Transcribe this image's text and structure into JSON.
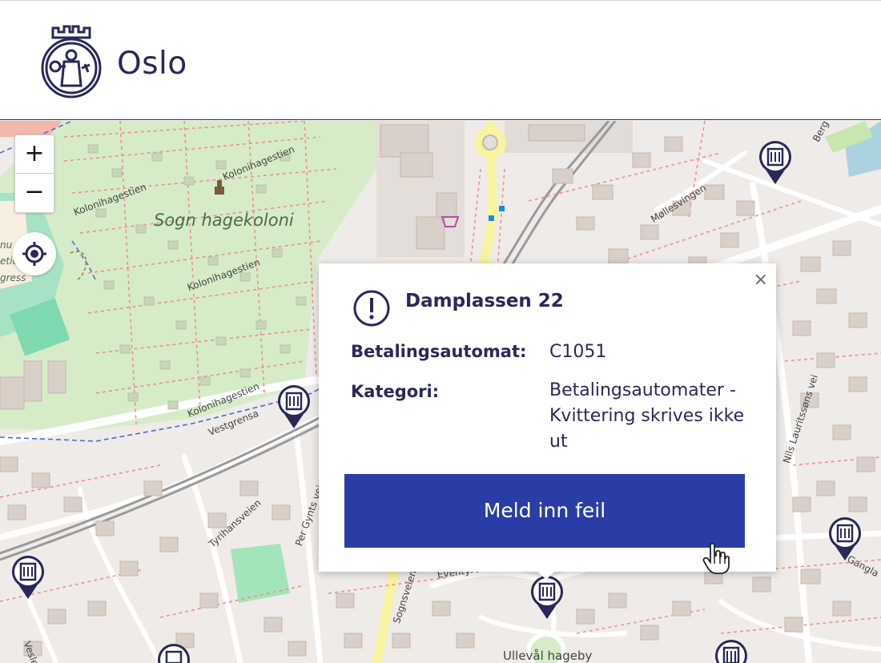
{
  "header": {
    "site_name": "Oslo"
  },
  "map": {
    "zoom_in": "+",
    "zoom_out": "−",
    "labels": {
      "park": "Sogn hagekoloni",
      "kolonihagestien": "Kolonihagestien",
      "vestgrensa": "Vestgrensa",
      "mollesvingen": "Møllesvingen",
      "tyrihansveien": "Tyrihansveien",
      "per_gynts_vei": "Per Gynts vei",
      "sognsveien": "Sognsveien",
      "eventyrveien": "Eventyrveien",
      "nils_lauritssons_vei": "Nils Lauritssøns vei",
      "ulleval_hageby": "Ullevål hageby",
      "veslefrik": "Veslefrik",
      "gangla": "Gangla",
      "berg": "Berg",
      "edge_label_1": "nu",
      "edge_label_2": "etic",
      "edge_label_3": "gress"
    }
  },
  "popup": {
    "title": "Damplassen 22",
    "close": "×",
    "rows": [
      {
        "label": "Betalingsautomat:",
        "value": "C1051"
      },
      {
        "label": "Kategori:",
        "value": "Betalingsautomater - Kvittering skrives ikke ut"
      }
    ],
    "button": "Meld inn feil"
  },
  "colors": {
    "brand_dark": "#2a2859",
    "button": "#2a3da6",
    "park_green": "#d6ecc9"
  }
}
